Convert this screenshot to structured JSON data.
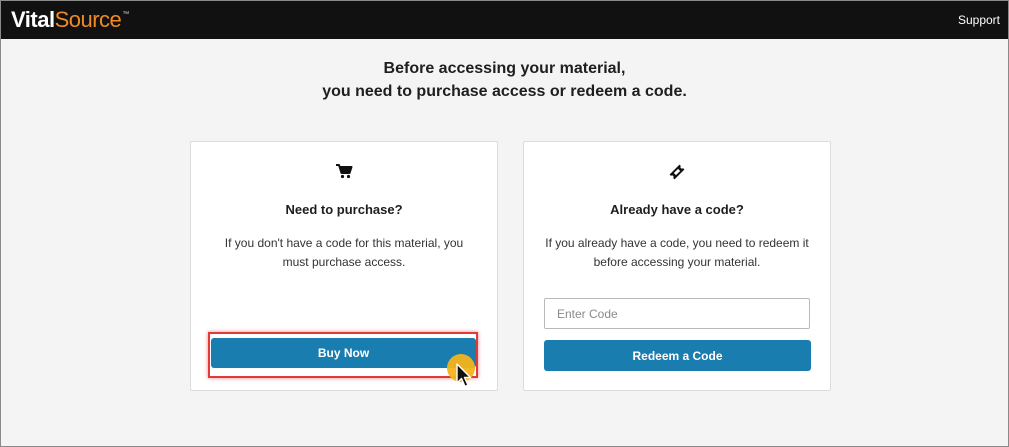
{
  "header": {
    "logo": {
      "part1": "Vital",
      "part2": "Source",
      "tm": "™"
    },
    "support_label": "Support"
  },
  "main": {
    "heading_line1": "Before accessing your material,",
    "heading_line2": "you need to purchase access or redeem a code."
  },
  "purchase_card": {
    "icon": "shopping-cart-icon",
    "title": "Need to purchase?",
    "description": "If you don't have a code for this material, you must purchase access.",
    "button_label": "Buy Now"
  },
  "redeem_card": {
    "icon": "ticket-icon",
    "title": "Already have a code?",
    "description": "If you already have a code, you need to redeem it before accessing your material.",
    "input": {
      "placeholder": "Enter Code",
      "value": ""
    },
    "button_label": "Redeem a Code"
  },
  "colors": {
    "topbar": "#111111",
    "brand_orange": "#f08a24",
    "button_blue": "#1a7db0",
    "highlight_red": "#e03a3a",
    "cursor_dot": "#f3b41b"
  }
}
